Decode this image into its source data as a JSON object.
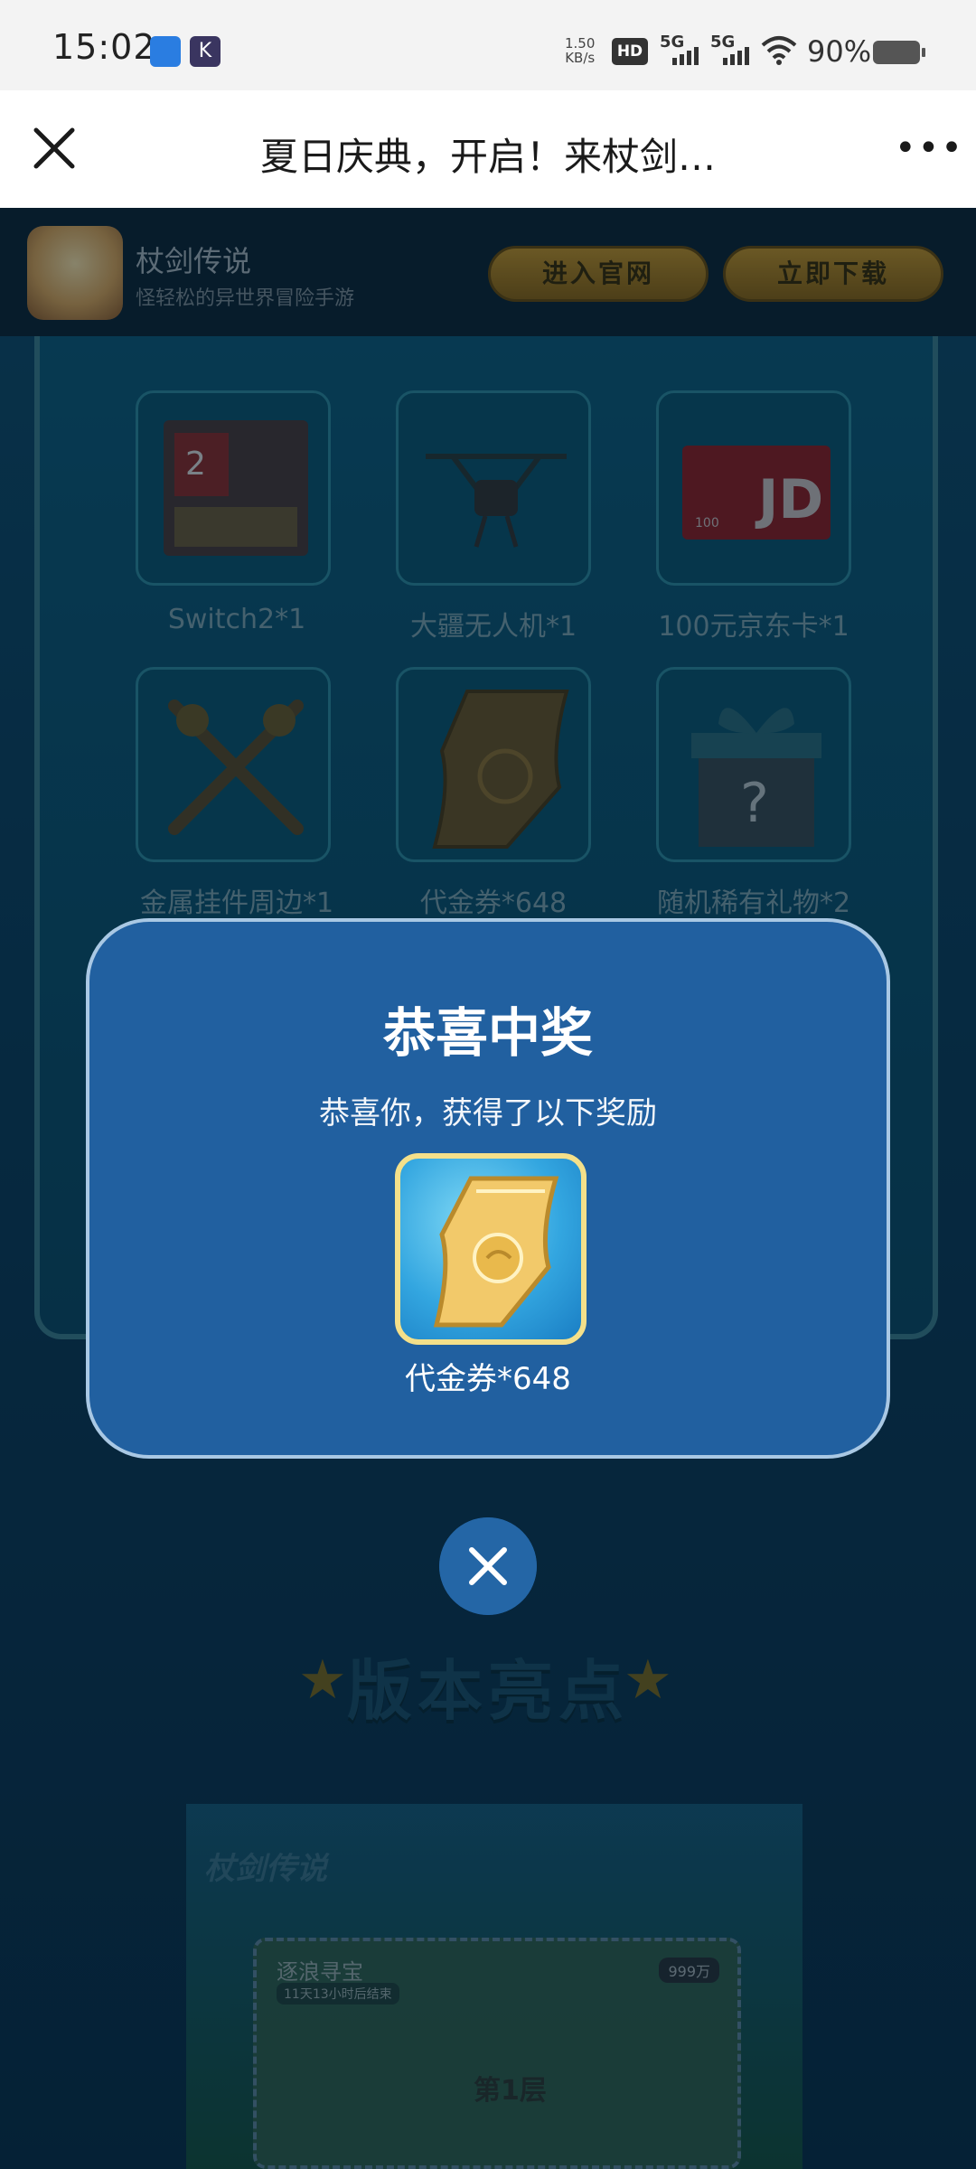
{
  "status_bar": {
    "time": "15:02",
    "net_speed_value": "1.50",
    "net_speed_unit": "KB/s",
    "hd_badge": "HD",
    "sim1_label": "5G",
    "sim2_label": "5G",
    "battery": "90%",
    "icons": [
      "app-notification-icon",
      "kuaishou-notification-icon",
      "hd-icon",
      "signal-icon",
      "wifi-icon",
      "battery-icon"
    ]
  },
  "header": {
    "title": "夏日庆典，开启！来杖剑…",
    "close_icon": "close-icon",
    "more_icon": "more-icon"
  },
  "app_bar": {
    "name": "杖剑传说",
    "desc": "怪轻松的异世界冒险手游",
    "official_button": "进入官网",
    "download_button": "立即下载"
  },
  "prizes": [
    {
      "label": "Switch2*1",
      "icon": "switch2-console-icon"
    },
    {
      "label": "大疆无人机*1",
      "icon": "drone-icon"
    },
    {
      "label": "100元京东卡*1",
      "icon": "jd-card-icon"
    },
    {
      "label": "金属挂件周边*1",
      "icon": "metal-pendant-icon"
    },
    {
      "label": "代金券*648",
      "icon": "voucher-icon"
    },
    {
      "label": "随机稀有礼物*2",
      "icon": "mystery-gift-icon"
    }
  ],
  "background": {
    "highlights_title": "版本亮点",
    "banner_logo": "杖剑传说",
    "ticket_title": "逐浪寻宝",
    "ticket_time": "11天13小时后结束",
    "ticket_badge": "999万",
    "ticket_floor": "第1层",
    "jd_card_value": "100"
  },
  "modal": {
    "title": "恭喜中奖",
    "subtitle": "恭喜你，获得了以下奖励",
    "reward_label": "代金券*648",
    "reward_icon": "voucher-icon",
    "close_icon": "close-icon"
  },
  "colors": {
    "modal_bg": "#2160a0",
    "modal_border": "#a9c8e4",
    "reward_frame": "#f4e08a",
    "app_button": "#c2922a"
  }
}
